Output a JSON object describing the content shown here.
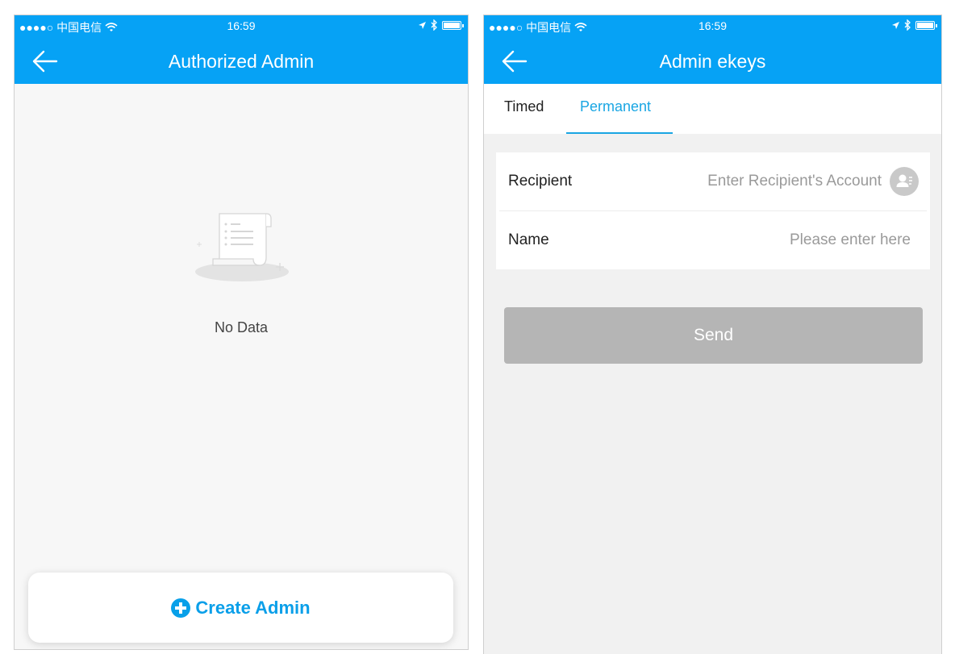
{
  "left_screen": {
    "status_bar": {
      "carrier": "●●●●○ 中国电信",
      "time": "16:59"
    },
    "nav": {
      "title": "Authorized Admin"
    },
    "empty_state": {
      "text": "No Data"
    },
    "create_button": {
      "label": "Create Admin"
    }
  },
  "right_screen": {
    "status_bar": {
      "carrier": "●●●●○ 中国电信",
      "time": "16:59"
    },
    "nav": {
      "title": "Admin ekeys"
    },
    "tabs": [
      {
        "label": "Timed",
        "active": false
      },
      {
        "label": "Permanent",
        "active": true
      }
    ],
    "form": {
      "recipient": {
        "label": "Recipient",
        "placeholder": "Enter Recipient's Account",
        "value": ""
      },
      "name": {
        "label": "Name",
        "placeholder": "Please enter here",
        "value": ""
      }
    },
    "send_button": {
      "label": "Send"
    }
  },
  "colors": {
    "header_blue": "#06a2f5",
    "accent_blue": "#1aa6e3",
    "disabled_gray": "#b5b5b5",
    "left_background": "#f7f7f7",
    "right_background": "#f1f1f1"
  },
  "icons": [
    "wifi-icon",
    "location-arrow-icon",
    "bluetooth-icon",
    "battery-icon",
    "back-arrow-icon",
    "empty-document-icon",
    "plus-circle-icon",
    "contact-icon"
  ]
}
